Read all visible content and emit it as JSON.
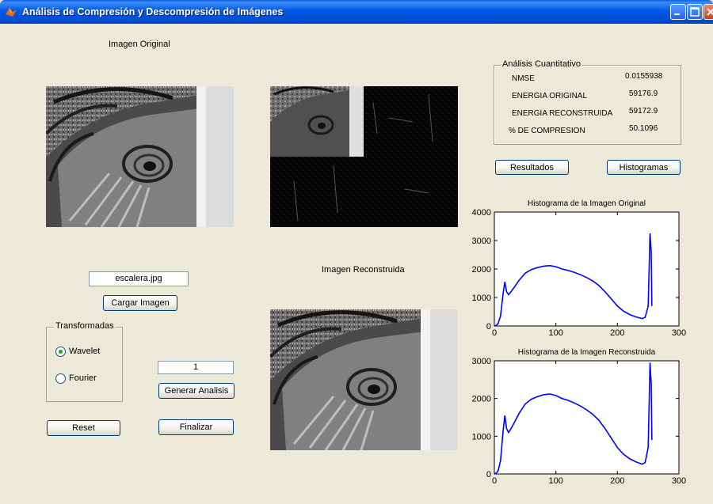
{
  "window": {
    "title": "Análisis de Compresión y Descompresión de Imágenes"
  },
  "labels": {
    "original_image": "Imagen Original",
    "reconstructed_image": "Imagen Reconstruida"
  },
  "file": {
    "name": "escalera.jpg",
    "load_button": "Cargar Imagen"
  },
  "transforms": {
    "title": "Transformadas",
    "options": [
      {
        "label": "Wavelet",
        "selected": true
      },
      {
        "label": "Fourier",
        "selected": false
      }
    ]
  },
  "analysis": {
    "level_value": "1",
    "generate_button": "Generar Analisis"
  },
  "buttons": {
    "reset": "Reset",
    "finish": "Finalizar",
    "results": "Resultados",
    "histograms": "Histogramas"
  },
  "quantitative": {
    "title": "Análisis Cuantitativo",
    "rows": [
      {
        "label": "NMSE",
        "value": "0.0155938"
      },
      {
        "label": "ENERGIA ORIGINAL",
        "value": "59176.9"
      },
      {
        "label": "ENERGIA RECONSTRUIDA",
        "value": "59172.9"
      },
      {
        "label": "% DE COMPRESION",
        "value": "50.1096"
      }
    ]
  },
  "colors": {
    "plot_line": "#0000ff",
    "panel_bg": "#ece9d8",
    "title_bar": "#0058e6"
  },
  "chart_data": [
    {
      "type": "line",
      "title": "Histograma de la Imagen Original",
      "xlim": [
        0,
        300
      ],
      "ylim": [
        0,
        4000
      ],
      "xticks": [
        0,
        100,
        200,
        300
      ],
      "yticks": [
        0,
        1000,
        2000,
        3000,
        4000
      ],
      "x": [
        0,
        3,
        6,
        10,
        14,
        17,
        20,
        23,
        27,
        32,
        40,
        50,
        60,
        70,
        80,
        90,
        100,
        110,
        120,
        130,
        140,
        150,
        160,
        170,
        180,
        190,
        200,
        210,
        220,
        230,
        240,
        245,
        250,
        253,
        255,
        256
      ],
      "y": [
        0,
        20,
        80,
        350,
        1100,
        1550,
        1200,
        1100,
        1200,
        1350,
        1600,
        1850,
        1980,
        2050,
        2100,
        2120,
        2080,
        2000,
        1950,
        1880,
        1800,
        1700,
        1580,
        1420,
        1200,
        950,
        700,
        520,
        400,
        320,
        260,
        300,
        700,
        3250,
        2600,
        700
      ]
    },
    {
      "type": "line",
      "title": "Histograma de la Imagen Reconstruida",
      "xlim": [
        0,
        300
      ],
      "ylim": [
        0,
        3000
      ],
      "xticks": [
        0,
        100,
        200,
        300
      ],
      "yticks": [
        0,
        1000,
        2000,
        3000
      ],
      "x": [
        0,
        3,
        6,
        10,
        14,
        17,
        20,
        23,
        27,
        32,
        40,
        50,
        60,
        70,
        80,
        90,
        100,
        110,
        120,
        130,
        140,
        150,
        160,
        170,
        180,
        190,
        200,
        210,
        220,
        230,
        240,
        245,
        250,
        253,
        255,
        256
      ],
      "y": [
        0,
        20,
        80,
        350,
        1100,
        1550,
        1200,
        1100,
        1200,
        1350,
        1600,
        1850,
        1980,
        2050,
        2100,
        2120,
        2080,
        2000,
        1950,
        1880,
        1800,
        1700,
        1580,
        1420,
        1200,
        950,
        700,
        520,
        400,
        320,
        260,
        300,
        700,
        2950,
        2400,
        900
      ]
    }
  ]
}
